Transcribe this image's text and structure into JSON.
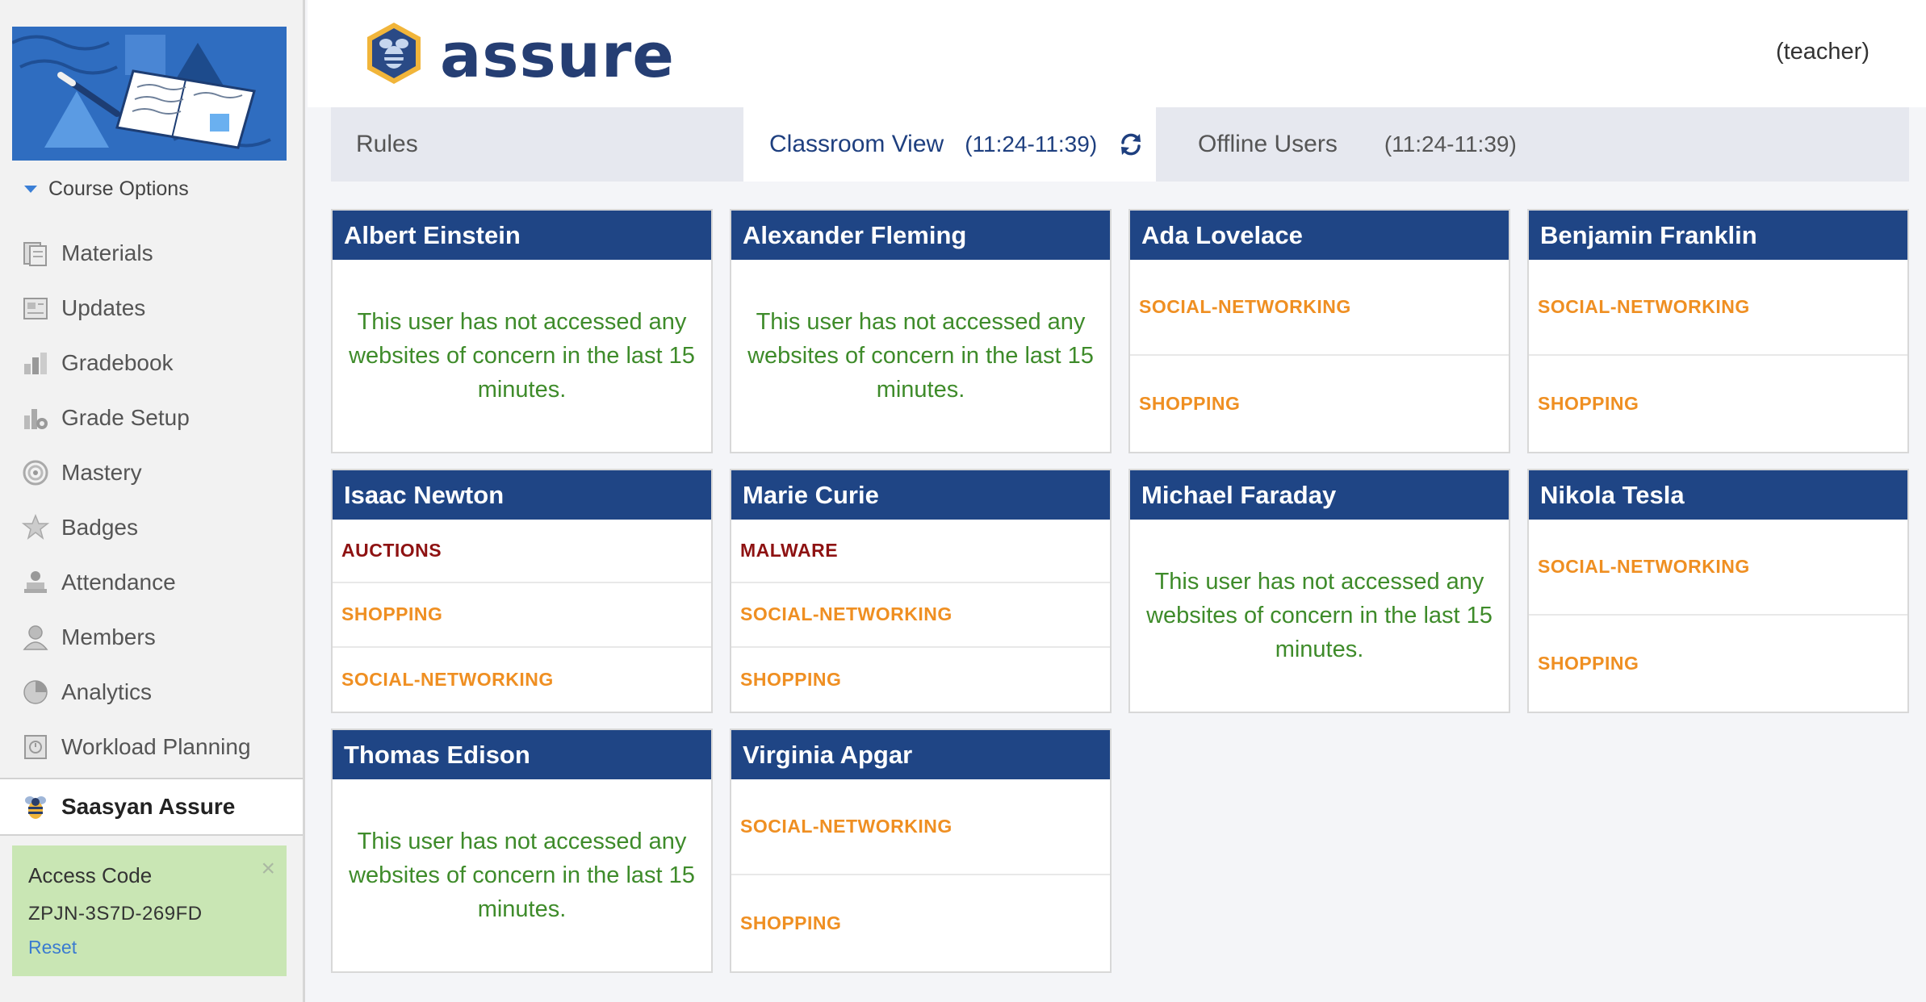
{
  "sidebar": {
    "course_options": "Course Options",
    "items": [
      {
        "label": "Materials",
        "icon": "materials-icon"
      },
      {
        "label": "Updates",
        "icon": "updates-icon"
      },
      {
        "label": "Gradebook",
        "icon": "gradebook-icon"
      },
      {
        "label": "Grade Setup",
        "icon": "grade-setup-icon"
      },
      {
        "label": "Mastery",
        "icon": "mastery-icon"
      },
      {
        "label": "Badges",
        "icon": "badges-icon"
      },
      {
        "label": "Attendance",
        "icon": "attendance-icon"
      },
      {
        "label": "Members",
        "icon": "members-icon"
      },
      {
        "label": "Analytics",
        "icon": "analytics-icon"
      },
      {
        "label": "Workload Planning",
        "icon": "workload-planning-icon"
      }
    ],
    "active_item": {
      "label": "Saasyan Assure",
      "icon": "bee-icon"
    },
    "access": {
      "title": "Access Code",
      "code": "ZPJN-3S7D-269FD",
      "reset": "Reset",
      "close": "×"
    }
  },
  "header": {
    "logo_text": "assure",
    "user_role": "(teacher)"
  },
  "tabs": {
    "rules": "Rules",
    "classroom": "Classroom View",
    "classroom_range": "(11:24-11:39)",
    "offline": "Offline Users",
    "offline_range": "(11:24-11:39)"
  },
  "colors": {
    "header_blue": "#1f4585",
    "no_access_green": "#3e8b2a",
    "category_orange": "#ef8f22",
    "category_red": "#8e1212",
    "access_green": "#c9e6b4"
  },
  "no_access_message": "This user has not accessed any websites of concern in the last 15 minutes.",
  "cards": [
    {
      "name": "Albert Einstein",
      "categories": []
    },
    {
      "name": "Alexander Fleming",
      "categories": []
    },
    {
      "name": "Ada Lovelace",
      "categories": [
        {
          "label": "SOCIAL-NETWORKING",
          "severity": "warning"
        },
        {
          "label": "SHOPPING",
          "severity": "warning"
        }
      ]
    },
    {
      "name": "Benjamin Franklin",
      "categories": [
        {
          "label": "SOCIAL-NETWORKING",
          "severity": "warning"
        },
        {
          "label": "SHOPPING",
          "severity": "warning"
        }
      ]
    },
    {
      "name": "Isaac Newton",
      "categories": [
        {
          "label": "AUCTIONS",
          "severity": "danger"
        },
        {
          "label": "SHOPPING",
          "severity": "warning"
        },
        {
          "label": "SOCIAL-NETWORKING",
          "severity": "warning"
        }
      ]
    },
    {
      "name": "Marie Curie",
      "categories": [
        {
          "label": "MALWARE",
          "severity": "danger"
        },
        {
          "label": "SOCIAL-NETWORKING",
          "severity": "warning"
        },
        {
          "label": "SHOPPING",
          "severity": "warning"
        }
      ]
    },
    {
      "name": "Michael Faraday",
      "categories": []
    },
    {
      "name": "Nikola Tesla",
      "categories": [
        {
          "label": "SOCIAL-NETWORKING",
          "severity": "warning"
        },
        {
          "label": "SHOPPING",
          "severity": "warning"
        }
      ]
    },
    {
      "name": "Thomas Edison",
      "categories": []
    },
    {
      "name": "Virginia Apgar",
      "categories": [
        {
          "label": "SOCIAL-NETWORKING",
          "severity": "warning"
        },
        {
          "label": "SHOPPING",
          "severity": "warning"
        }
      ]
    }
  ]
}
